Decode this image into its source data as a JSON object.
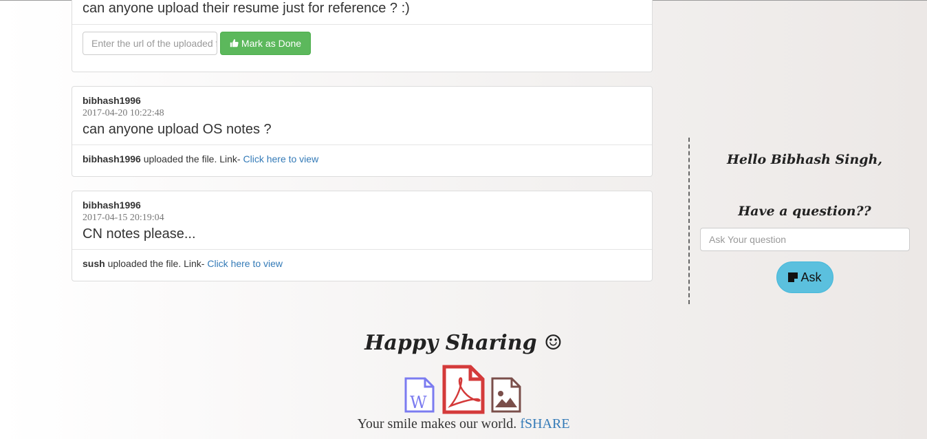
{
  "posts": [
    {
      "question": "can anyone upload their resume just for reference ? :)",
      "url_placeholder": "Enter the url of the uploaded file",
      "done_label": "Mark as Done"
    },
    {
      "user": "bibhash1996",
      "date": "2017-04-20 10:22:48",
      "question": "can anyone upload OS notes ?",
      "uploader": "bibhash1996",
      "uploaded_text": " uploaded the file. Link- ",
      "link_label": "Click here to view"
    },
    {
      "user": "bibhash1996",
      "date": "2017-04-15 20:19:04",
      "question": "CN notes please...",
      "uploader": "sush",
      "uploaded_text": " uploaded the file. Link- ",
      "link_label": "Click here to view"
    }
  ],
  "sidebar": {
    "greeting": "Hello Bibhash Singh,",
    "prompt": "Have a question??",
    "ask_placeholder": "Ask Your question",
    "ask_label": "Ask"
  },
  "footer": {
    "happy": "Happy Sharing ☺",
    "tagline_prefix": "Your smile makes our world. ",
    "brand": "fSHARE",
    "icons": [
      "word-file-icon",
      "pdf-file-icon",
      "image-file-icon"
    ]
  },
  "colors": {
    "success": "#5cb85c",
    "info": "#5bc0de",
    "link": "#337ab7",
    "word": "#7b7bf0",
    "pdf": "#d43a3a",
    "image": "#7a4e4a"
  }
}
